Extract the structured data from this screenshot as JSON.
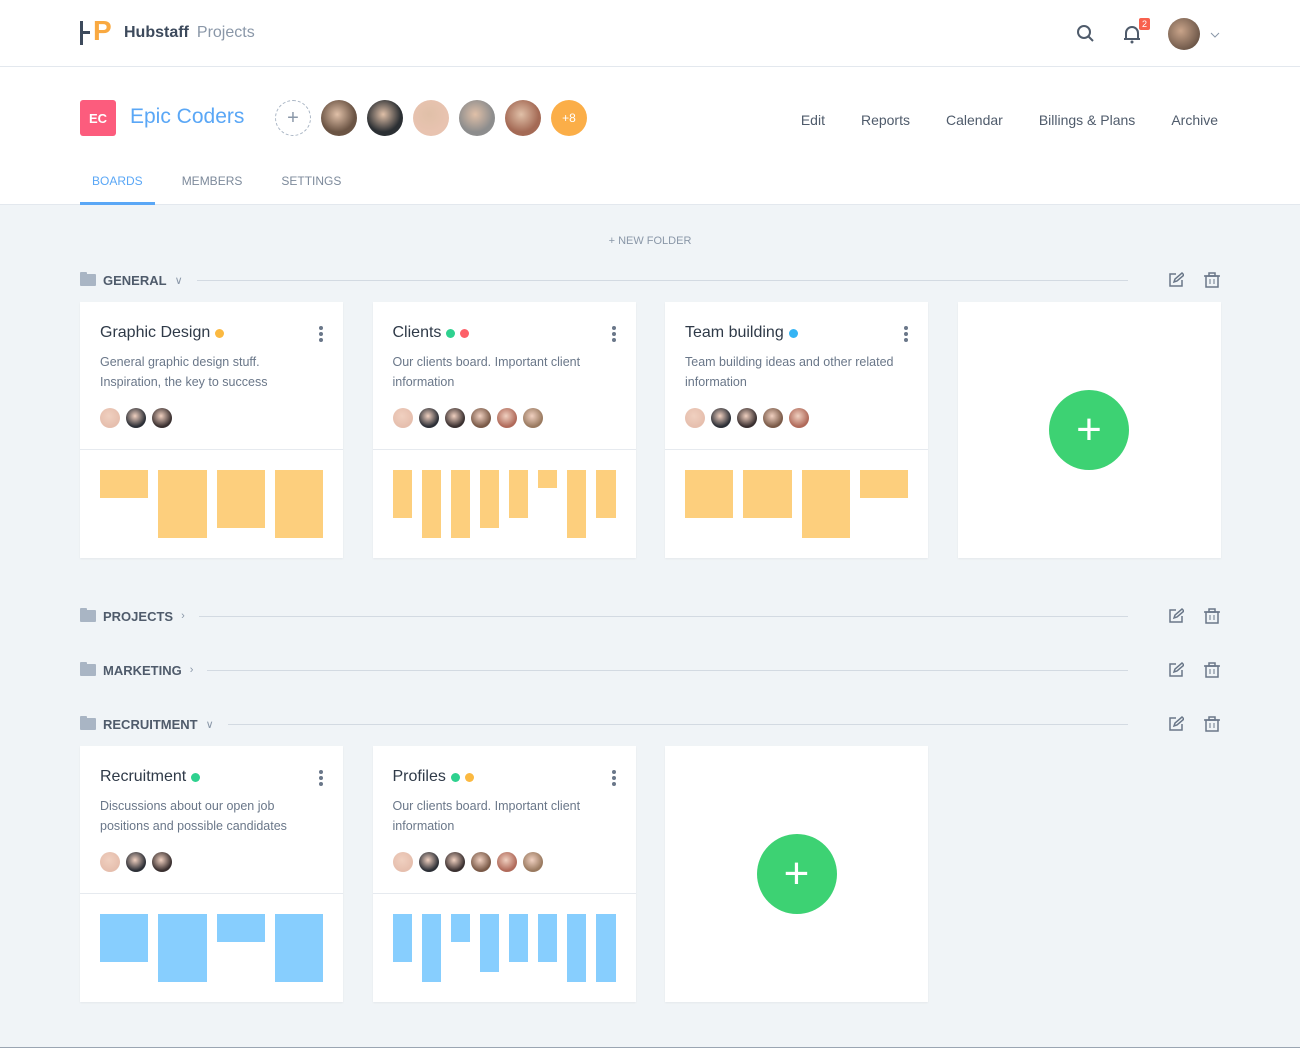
{
  "app": {
    "brand": "Hubstaff",
    "product": "Projects",
    "notifications": "2"
  },
  "project": {
    "initials": "EC",
    "name": "Epic Coders",
    "more_members": "+8",
    "member_colors": [
      "#6b5444",
      "#2b2f33",
      "#e8c3b0",
      "#8d8d8d",
      "#a46a55"
    ],
    "nav": [
      "Edit",
      "Reports",
      "Calendar",
      "Billings & Plans",
      "Archive"
    ],
    "tabs": [
      "BOARDS",
      "MEMBERS",
      "SETTINGS"
    ],
    "active_tab": 0
  },
  "new_folder": "NEW FOLDER",
  "colors": {
    "yellow": "#fbb941",
    "green": "#2ed18f",
    "red": "#fd6068",
    "blue": "#35b4f4",
    "chart_yellow": "#fdcf7d",
    "chart_blue": "#87cefe"
  },
  "folders": [
    {
      "name": "GENERAL",
      "expanded": true,
      "boards": [
        {
          "title": "Graphic Design",
          "dots": [
            "#fbb941"
          ],
          "desc": "General graphic design stuff. Inspiration, the key to success",
          "members": 3,
          "chart_color": "#fdcf7d",
          "blocks": [
            0.41,
            1,
            0.85,
            1
          ]
        },
        {
          "title": "Clients",
          "dots": [
            "#2ed18f",
            "#fd6068"
          ],
          "desc": "Our clients board. Important client information",
          "members": 6,
          "chart_color": "#fdcf7d",
          "blocks": [
            0.7,
            1,
            1,
            0.85,
            0.7,
            0.26,
            1,
            0.7
          ]
        },
        {
          "title": "Team building",
          "dots": [
            "#35b4f4"
          ],
          "desc": "Team building ideas and other related information",
          "members": 5,
          "chart_color": "#fdcf7d",
          "blocks": [
            0.7,
            0.7,
            1,
            0.41
          ]
        }
      ]
    },
    {
      "name": "PROJECTS",
      "expanded": false,
      "boards": []
    },
    {
      "name": "MARKETING",
      "expanded": false,
      "boards": []
    },
    {
      "name": "RECRUITMENT",
      "expanded": true,
      "boards": [
        {
          "title": "Recruitment",
          "dots": [
            "#2ed18f"
          ],
          "desc": "Discussions about our open job positions and possible candidates",
          "members": 3,
          "chart_color": "#87cefe",
          "blocks": [
            0.7,
            1,
            0.41,
            1
          ]
        },
        {
          "title": "Profiles",
          "dots": [
            "#2ed18f",
            "#fbb941"
          ],
          "desc": "Our clients board. Important client information",
          "members": 6,
          "chart_color": "#87cefe",
          "blocks": [
            0.7,
            1,
            0.41,
            0.85,
            0.7,
            0.7,
            1,
            1
          ]
        }
      ]
    }
  ]
}
